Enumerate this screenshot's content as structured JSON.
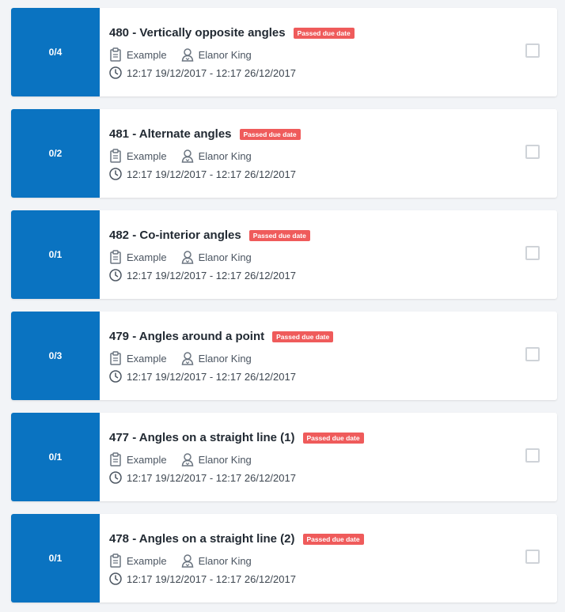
{
  "colors": {
    "score_background": "#0a73c1",
    "badge_background": "#ef5b5b",
    "page_background": "#f2f4f7"
  },
  "assignments": [
    {
      "score": "0/4",
      "title": "480 - Vertically opposite angles",
      "badge": "Passed due date",
      "group": "Example",
      "teacher": "Elanor King",
      "date_range": "12:17 19/12/2017 - 12:17 26/12/2017"
    },
    {
      "score": "0/2",
      "title": "481 - Alternate angles",
      "badge": "Passed due date",
      "group": "Example",
      "teacher": "Elanor King",
      "date_range": "12:17 19/12/2017 - 12:17 26/12/2017"
    },
    {
      "score": "0/1",
      "title": "482 - Co-interior angles",
      "badge": "Passed due date",
      "group": "Example",
      "teacher": "Elanor King",
      "date_range": "12:17 19/12/2017 - 12:17 26/12/2017"
    },
    {
      "score": "0/3",
      "title": "479 - Angles around a point",
      "badge": "Passed due date",
      "group": "Example",
      "teacher": "Elanor King",
      "date_range": "12:17 19/12/2017 - 12:17 26/12/2017"
    },
    {
      "score": "0/1",
      "title": "477 - Angles on a straight line (1)",
      "badge": "Passed due date",
      "group": "Example",
      "teacher": "Elanor King",
      "date_range": "12:17 19/12/2017 - 12:17 26/12/2017"
    },
    {
      "score": "0/1",
      "title": "478 - Angles on a straight line (2)",
      "badge": "Passed due date",
      "group": "Example",
      "teacher": "Elanor King",
      "date_range": "12:17 19/12/2017 - 12:17 26/12/2017"
    }
  ]
}
